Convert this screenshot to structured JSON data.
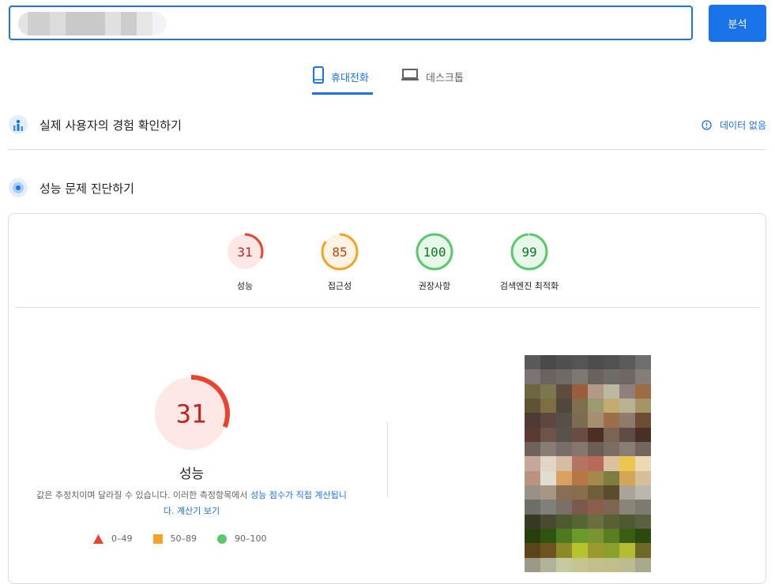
{
  "search": {
    "value": "",
    "analyze_label": "분석"
  },
  "tabs": [
    {
      "label": "휴대전화",
      "active": true
    },
    {
      "label": "데스크톱",
      "active": false
    }
  ],
  "field_data": {
    "title": "실제 사용자의 경험 확인하기",
    "status": "데이터 없음"
  },
  "diagnose": {
    "title": "성능 문제 진단하기"
  },
  "scores": [
    {
      "value": "31",
      "label": "성능",
      "color": "#e8442f",
      "bg": "#fde8e6",
      "fraction": 0.31
    },
    {
      "value": "85",
      "label": "접근성",
      "color": "#f4a32a",
      "bg": "#fff4e3",
      "fraction": 0.85
    },
    {
      "value": "100",
      "label": "권장사항",
      "color": "#5bc86c",
      "bg": "#e7f7ea",
      "fraction": 1.0
    },
    {
      "value": "99",
      "label": "검색엔진 최적화",
      "color": "#5bc86c",
      "bg": "#e7f7ea",
      "fraction": 0.99
    }
  ],
  "main": {
    "score": "31",
    "fraction": 0.31,
    "title": "성능",
    "desc_prefix": "값은 추정치이며 달라질 수 있습니다. 이러한 측정항목에서 ",
    "desc_link1": "성능 점수가 직접 계산됩니",
    "desc_link1b": "다.",
    "desc_link2": "계산기 보기"
  },
  "legend": [
    {
      "label": "0–49",
      "color": "#e8442f",
      "shape": "triangle"
    },
    {
      "label": "50–89",
      "color": "#f4a32a",
      "shape": "square"
    },
    {
      "label": "90–100",
      "color": "#5bc86c",
      "shape": "circle"
    }
  ],
  "screenshot_colors": [
    "#5a5a5a",
    "#4a4a4a",
    "#505050",
    "#555555",
    "#4d4d4d",
    "#525252",
    "#5b5b5b",
    "#6e6e6e",
    "#7a7371",
    "#6b6360",
    "#6f6a68",
    "#7d7872",
    "#6a6260",
    "#716b68",
    "#6e6765",
    "#857d78",
    "#6e6640",
    "#7d7750",
    "#5e4d3f",
    "#9a5d3e",
    "#b39a88",
    "#b9bba0",
    "#907f7c",
    "#9d6b44",
    "#5e5335",
    "#7d6e43",
    "#52473d",
    "#7f6f4f",
    "#9b9b6f",
    "#c1ab6e",
    "#b8b293",
    "#a59566",
    "#4f3a35",
    "#5d4740",
    "#575048",
    "#7b6c52",
    "#a58f6f",
    "#9c6f4a",
    "#8e7b6c",
    "#6d4d36",
    "#5a3a33",
    "#6e534a",
    "#5a514b",
    "#6a4d41",
    "#4d2e25",
    "#7a6454",
    "#5e4c45",
    "#4a2f25",
    "#6e625b",
    "#887c73",
    "#796e67",
    "#85776f",
    "#6c5e55",
    "#7c6c63",
    "#8a7d74",
    "#72665e",
    "#c5a89a",
    "#e2d5c5",
    "#d7bca4",
    "#b37561",
    "#b8695a",
    "#dcc1a0",
    "#eac54f",
    "#ead9b2",
    "#b89480",
    "#e0ddd3",
    "#d9a060",
    "#b77745",
    "#a5894a",
    "#7e7e3f",
    "#d3a656",
    "#d6bf98",
    "#9a9186",
    "#a89685",
    "#8a6d55",
    "#8a6d4a",
    "#6e5f3a",
    "#5c4c2e",
    "#a9a39a",
    "#bbb7ae",
    "#6f6f6a",
    "#817f7a",
    "#7b6f68",
    "#7b5a4d",
    "#8a5e48",
    "#7e6553",
    "#8a8579",
    "#7d7a72",
    "#3a3a22",
    "#4a4a30",
    "#4e5a30",
    "#556633",
    "#6a6e40",
    "#596034",
    "#505a30",
    "#5a6040",
    "#263f0d",
    "#2e5410",
    "#4d7a1f",
    "#6a9a2c",
    "#7a9432",
    "#5a7c22",
    "#3a5e12",
    "#2c4a0f",
    "#5a4418",
    "#6e5320",
    "#8c8a26",
    "#b8c22c",
    "#9a9a2e",
    "#8aa02a",
    "#b6bb36",
    "#6e6a26",
    "#9c9a86",
    "#b2b298",
    "#c6c8a0",
    "#c6c490",
    "#c2c088",
    "#c0bf8c",
    "#bdbb92",
    "#a8a88c"
  ]
}
